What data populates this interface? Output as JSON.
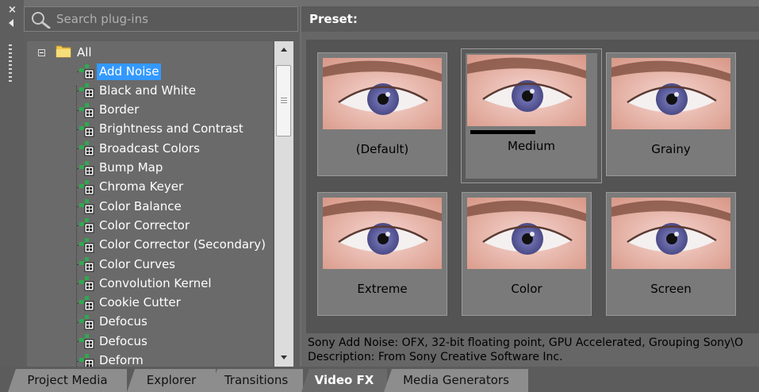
{
  "window": {
    "close_glyph": "×"
  },
  "search": {
    "placeholder": "Search plug-ins"
  },
  "tree": {
    "root_label": "All",
    "items": [
      {
        "label": "Add Noise",
        "selected": true
      },
      {
        "label": "Black and White"
      },
      {
        "label": "Border"
      },
      {
        "label": "Brightness and Contrast"
      },
      {
        "label": "Broadcast Colors"
      },
      {
        "label": "Bump Map"
      },
      {
        "label": "Chroma Keyer"
      },
      {
        "label": "Color Balance"
      },
      {
        "label": "Color Corrector"
      },
      {
        "label": "Color Corrector (Secondary)"
      },
      {
        "label": "Color Curves"
      },
      {
        "label": "Convolution Kernel"
      },
      {
        "label": "Cookie Cutter"
      },
      {
        "label": "Defocus"
      },
      {
        "label": "Defocus"
      },
      {
        "label": "Deform"
      }
    ]
  },
  "preset_panel": {
    "header": "Preset:",
    "presets": [
      {
        "name": "(Default)"
      },
      {
        "name": "Medium",
        "selected": true
      },
      {
        "name": "Grainy"
      },
      {
        "name": "Extreme"
      },
      {
        "name": "Color"
      },
      {
        "name": "Screen"
      }
    ],
    "description_line1": "Sony Add Noise: OFX, 32-bit floating point, GPU Accelerated, Grouping Sony\\O",
    "description_line2": "Description: From Sony Creative Software Inc."
  },
  "tabs": [
    {
      "label": "Project Media"
    },
    {
      "label": "Explorer"
    },
    {
      "label": "Transitions"
    },
    {
      "label": "Video FX",
      "active": true
    },
    {
      "label": "Media Generators"
    }
  ],
  "colors": {
    "selection": "#3399ff",
    "panel_bg": "#666666",
    "tab_bg": "#8d8d8d",
    "tab_active_bg": "#6a6a6a"
  }
}
